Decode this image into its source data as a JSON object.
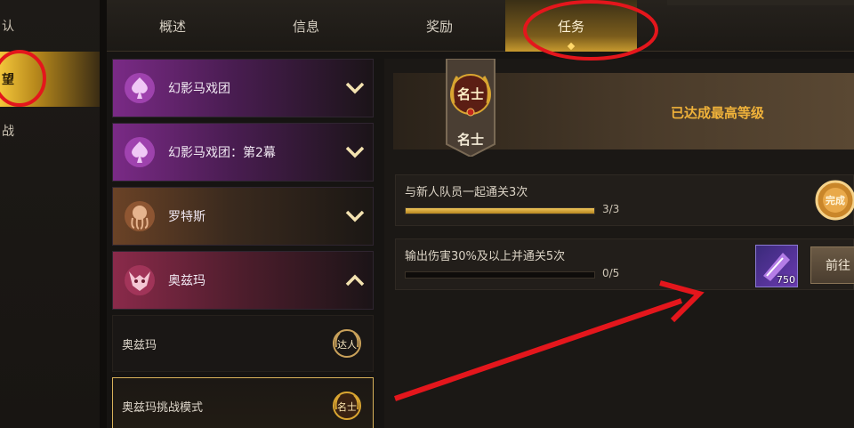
{
  "left_nav": {
    "items": [
      {
        "label": "认"
      },
      {
        "label": "望"
      },
      {
        "label": "战"
      }
    ]
  },
  "tabs": [
    {
      "label": "概述"
    },
    {
      "label": "信息"
    },
    {
      "label": "奖励"
    },
    {
      "label": "任务"
    }
  ],
  "groups": [
    {
      "label": "幻影马戏团"
    },
    {
      "label": "幻影马戏团：第2幕"
    },
    {
      "label": "罗特斯"
    },
    {
      "label": "奥兹玛"
    }
  ],
  "sub_items": [
    {
      "label": "奥兹玛",
      "badge": "达人"
    },
    {
      "label": "奥兹玛挑战模式",
      "badge": "名士"
    }
  ],
  "rank": {
    "emblem_text": "名士",
    "name": "名士",
    "status": "已达成最高等级"
  },
  "tasks": [
    {
      "text": "与新人队员一起通关3次",
      "progress": "3/3",
      "fraction": 1.0,
      "reward_badge": "完成"
    },
    {
      "text": "输出伤害30%及以上并通关5次",
      "progress": "0/5",
      "fraction": 0.0,
      "reward_qty": "750",
      "button": "前往"
    }
  ],
  "colors": {
    "accent": "#d9a531",
    "annotation": "#e4161c"
  }
}
